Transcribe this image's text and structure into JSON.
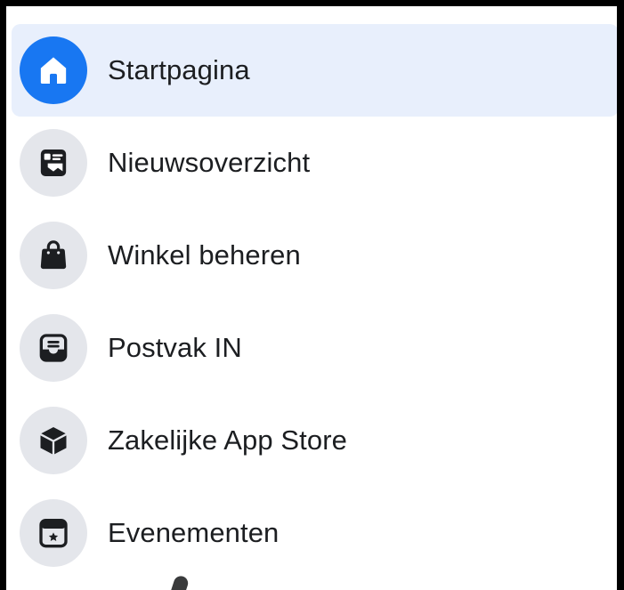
{
  "nav": {
    "items": [
      {
        "label": "Startpagina",
        "icon": "home-icon",
        "active": true
      },
      {
        "label": "Nieuwsoverzicht",
        "icon": "news-feed-icon",
        "active": false
      },
      {
        "label": "Winkel beheren",
        "icon": "shopping-bag-icon",
        "active": false
      },
      {
        "label": "Postvak IN",
        "icon": "inbox-icon",
        "active": false
      },
      {
        "label": "Zakelijke App Store",
        "icon": "cube-icon",
        "active": false
      },
      {
        "label": "Evenementen",
        "icon": "calendar-star-icon",
        "active": false
      }
    ]
  },
  "colors": {
    "accent": "#1877f2",
    "active_background": "#e8effc",
    "icon_background": "#e4e6eb",
    "icon_glyph": "#1c1e21",
    "text": "#1c1e21"
  }
}
